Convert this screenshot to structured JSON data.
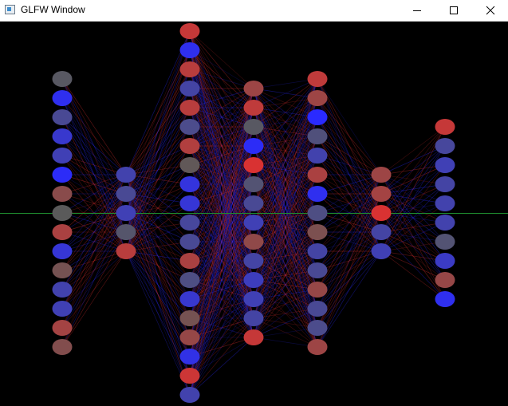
{
  "window": {
    "title": "GLFW Window",
    "icon": "app-window-icon",
    "controls": [
      {
        "name": "minimize",
        "icon": "minimize-icon"
      },
      {
        "name": "maximize",
        "icon": "maximize-icon"
      },
      {
        "name": "close",
        "icon": "close-icon"
      }
    ]
  },
  "network": {
    "colors": {
      "background": "#000000",
      "positive": "#e03030",
      "negative": "#2a2aff",
      "axis": "#1e8a2e"
    },
    "layers": [
      [
        -0.05,
        -0.9,
        -0.35,
        -0.7,
        -0.55,
        -0.95,
        0.35,
        0.0,
        0.6,
        -0.75,
        0.2,
        -0.5,
        -0.55,
        0.55,
        0.3
      ],
      [
        -0.5,
        -0.35,
        -0.55,
        -0.1,
        0.7
      ],
      [
        0.8,
        -0.9,
        0.7,
        -0.45,
        0.7,
        -0.3,
        0.65,
        0.05,
        -0.8,
        -0.75,
        -0.4,
        -0.35,
        0.6,
        -0.25,
        -0.7,
        0.2,
        0.45,
        -0.85,
        0.85,
        -0.5
      ],
      [
        0.5,
        0.75,
        -0.05,
        -0.95,
        0.95,
        -0.15,
        -0.35,
        -0.55,
        0.4,
        -0.45,
        -0.6,
        -0.55,
        -0.45,
        0.8
      ],
      [
        0.75,
        0.5,
        -1.0,
        -0.2,
        -0.5,
        0.6,
        -0.9,
        -0.25,
        0.25,
        -0.45,
        -0.35,
        0.45,
        -0.35,
        -0.3,
        0.5
      ],
      [
        0.5,
        0.55,
        0.95,
        -0.45,
        -0.55
      ],
      [
        0.8,
        -0.4,
        -0.55,
        -0.45,
        -0.5,
        -0.5,
        -0.15,
        -0.65,
        0.45,
        -0.9
      ]
    ]
  }
}
